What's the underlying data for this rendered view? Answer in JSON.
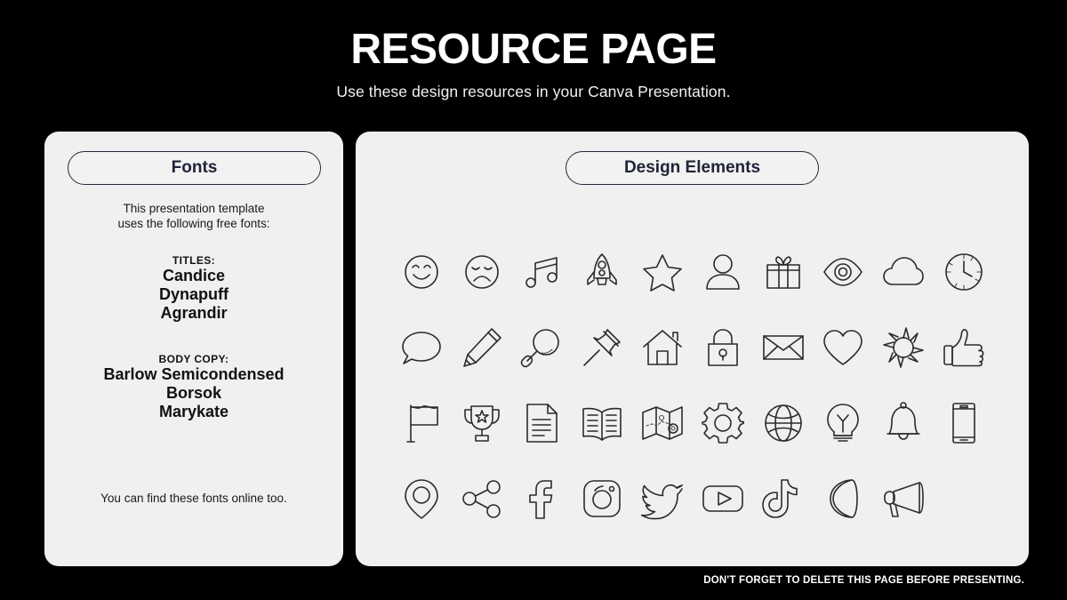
{
  "header": {
    "title": "RESOURCE PAGE",
    "subtitle": "Use these design resources in your Canva Presentation."
  },
  "fonts_panel": {
    "heading": "Fonts",
    "intro_line_1": "This presentation template",
    "intro_line_2": "uses the following free fonts:",
    "titles_label": "TITLES:",
    "titles_fonts": [
      "Candice",
      "Dynapuff",
      "Agrandir"
    ],
    "body_label": "BODY COPY:",
    "body_fonts": [
      "Barlow Semicondensed",
      "Borsok",
      "Marykate"
    ],
    "footnote": "You can find these fonts online too."
  },
  "elements_panel": {
    "heading": "Design Elements",
    "icons": [
      "smiley-face-icon",
      "sad-face-icon",
      "music-note-icon",
      "rocket-icon",
      "star-icon",
      "person-icon",
      "gift-icon",
      "eye-icon",
      "cloud-icon",
      "clock-icon",
      "speech-bubble-icon",
      "pencil-icon",
      "magnifying-glass-icon",
      "pushpin-icon",
      "house-icon",
      "lock-icon",
      "envelope-icon",
      "heart-icon",
      "sun-icon",
      "thumbs-up-icon",
      "flag-icon",
      "trophy-icon",
      "document-icon",
      "book-icon",
      "map-icon",
      "gear-icon",
      "globe-icon",
      "lightbulb-icon",
      "bell-icon",
      "smartphone-icon",
      "location-pin-icon",
      "share-icon",
      "facebook-icon",
      "instagram-icon",
      "twitter-icon",
      "youtube-icon",
      "tiktok-icon",
      "moon-icon",
      "megaphone-icon"
    ]
  },
  "footer": {
    "note": "DON'T FORGET TO DELETE THIS PAGE BEFORE PRESENTING."
  },
  "colors": {
    "background": "#000000",
    "panel": "#f0f0f0",
    "accent_dark": "#252a3d",
    "text_light": "#ffffff",
    "icon_stroke": "#2b2b2b"
  }
}
